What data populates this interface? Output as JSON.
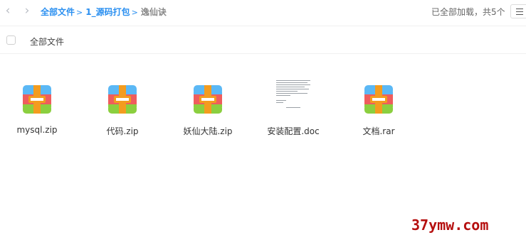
{
  "nav": {
    "back_icon": "chevron-left-icon",
    "forward_icon": "chevron-right-icon"
  },
  "breadcrumb": {
    "items": [
      "全部文件",
      "1_源码打包"
    ],
    "separator": ">",
    "current": "逸仙诀"
  },
  "status_text": "已全部加载，共5个",
  "view_toggle_icon": "list-view-icon",
  "header": {
    "select_all_label": "全部文件"
  },
  "files": [
    {
      "name": "mysql.zip",
      "type": "zip",
      "icon": "archive-icon"
    },
    {
      "name": "代码.zip",
      "type": "zip",
      "icon": "archive-icon"
    },
    {
      "name": "妖仙大陆.zip",
      "type": "zip",
      "icon": "archive-icon"
    },
    {
      "name": "安装配置.doc",
      "type": "doc",
      "icon": "document-thumbnail"
    },
    {
      "name": "文档.rar",
      "type": "rar",
      "icon": "archive-icon"
    }
  ],
  "archive_icon_colors": {
    "top": "#5bb8f5",
    "middle": "#ef5d5d",
    "bottom": "#8bcf3f",
    "strap": "#f39c1f"
  },
  "watermark": "37ymw.com",
  "colors": {
    "accent": "#2a8ff0",
    "watermark": "#b50f0f"
  }
}
